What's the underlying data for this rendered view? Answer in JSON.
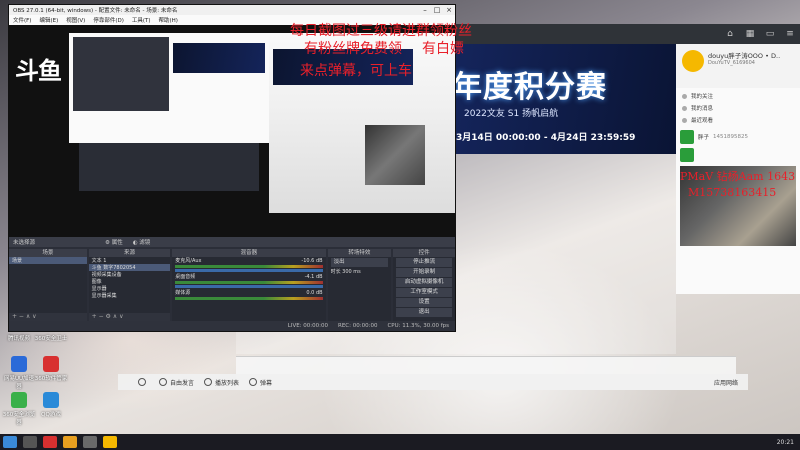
{
  "overlay": {
    "line1": "每日截图过三级请进群领粉丝",
    "line2": "有粉丝牌免费领",
    "line3": "有白嫖",
    "line4": "来点弹幕，可上车",
    "contact1": "PMaV 钻杨Aam 1643",
    "contact2": "M15738163415"
  },
  "obs": {
    "title": "OBS 27.0.1 (64-bit, windows) - 配置文件: 未命名 - 场景: 未命名",
    "menu": [
      "文件(F)",
      "编辑(E)",
      "视图(V)",
      "停靠部件(D)",
      "工具(T)",
      "帮助(H)"
    ],
    "logo": "斗鱼",
    "scene_bar": "未选择源",
    "props_label": "属性",
    "filters_label": "滤镜",
    "docks": {
      "scenes": {
        "title": "场景",
        "items": [
          "场景"
        ]
      },
      "sources": {
        "title": "来源",
        "items": [
          "文本 1",
          "斗鱼 数字7802054",
          "视频采集设备",
          "图像",
          "显示器",
          "显示器采集"
        ]
      },
      "mixer": {
        "title": "混音器",
        "channels": [
          {
            "name": "麦克风/Aux",
            "db": "-10.6 dB"
          },
          {
            "name": "桌面音频",
            "db": "-4.1 dB"
          },
          {
            "name": "媒体源",
            "db": "0.0 dB"
          }
        ]
      },
      "transitions": {
        "title": "转场特效",
        "type": "淡出",
        "duration_label": "时长",
        "duration": "300 ms"
      },
      "controls": {
        "title": "控件",
        "buttons": [
          "停止推流",
          "开始录制",
          "启动虚拟摄像机",
          "工作室模式",
          "设置",
          "退出"
        ]
      }
    },
    "status": {
      "live": "LIVE: 00:00:00",
      "rec": "REC: 00:00:00",
      "cpu": "CPU: 11.3%, 30.00 fps"
    }
  },
  "douyu": {
    "banner_title": "年度积分赛",
    "banner_sub": "2022文友 S1 扬帆启航",
    "banner_date": "3月14日 00:00:00 - 4月24日 23:59:59",
    "top_icons": [
      "home-icon",
      "grid-icon",
      "tv-icon",
      "menu-icon"
    ],
    "user": {
      "nick": "douyu胖子涛OOO • D..",
      "id": "DouYuTV_6169604"
    },
    "menu_items": [
      "我的关注",
      "我的消息",
      "最近观看"
    ],
    "follow_name": "胖子",
    "follow_id": "1451895825",
    "toolbar": [
      "自由发言",
      "播放列表",
      "弹幕"
    ],
    "apply": "应用网络"
  },
  "desktop_icons": [
    "腾讯视频",
    "360安全卫士",
    "网易UU加速器",
    "360软件管家",
    "360安全浏览器",
    "QQ游戏"
  ],
  "taskbar": {
    "time": "20:21"
  },
  "colors": {
    "overlay_red": "#e8202a",
    "obs_bg": "#2b2e38",
    "banner_glow": "#4fa3ff"
  }
}
